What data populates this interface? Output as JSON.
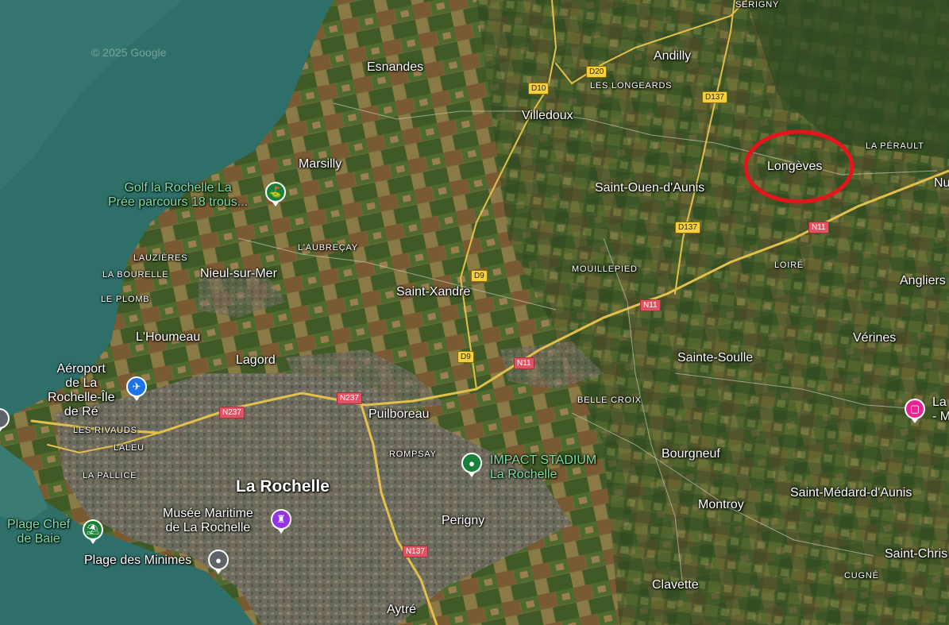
{
  "copyright": "© 2025 Google",
  "localities": {
    "serigny": "SERIGNY",
    "esnandes": "Esnandes",
    "andilly": "Andilly",
    "les_longeards": "LES LONGEARDS",
    "villedoux": "Villedoux",
    "la_perault": "LA PÉRAULT",
    "longeves": "Longèves",
    "nu": "Nu",
    "marsilly": "Marsilly",
    "saint_ouen": "Saint-Ouen-d'Aunis",
    "laubrecay": "L'AUBREÇAY",
    "lauzieres": "LAUZIÈRES",
    "la_bourelle": "LA BOURELLE",
    "nieul": "Nieul-sur-Mer",
    "mouillepied": "MOUILLEPIED",
    "loire": "LOIRÉ",
    "angliers": "Angliers",
    "le_plomb": "LE PLOMB",
    "saint_xandre": "Saint-Xandre",
    "lhoumeau": "L'Houmeau",
    "verines": "Vérines",
    "lagord": "Lagord",
    "sainte_soulle": "Sainte-Soulle",
    "belle_croix": "BELLE CROIX",
    "les_rivauds": "LES RIVAUDS",
    "puilboreau": "Puilboreau",
    "laleu": "LALEU",
    "rompsay": "ROMPSAY",
    "bourgneuf": "Bourgneuf",
    "la_pallice": "LA PALLICE",
    "la_rochelle": "La Rochelle",
    "montroy": "Montroy",
    "saint_medard": "Saint-Médard-d'Aunis",
    "perigny": "Perigny",
    "saint_chris": "Saint-Chris",
    "cugne": "CUGNÉ",
    "clavette": "Clavette",
    "aytre": "Aytré"
  },
  "pois": {
    "golf_line1": "Golf la Rochelle La",
    "golf_line2": "Prée parcours 18 trous...",
    "aeroport_line1": "Aéroport",
    "aeroport_line2": "de La",
    "aeroport_line3": "Rochelle-Île",
    "aeroport_line4": "de Ré",
    "stadium_line1": "IMPACT STADIUM",
    "stadium_line2": "La Rochelle",
    "musee_line1": "Musée Maritime",
    "musee_line2": "de La Rochelle",
    "plage_chef_line1": "Plage Chef",
    "plage_chef_line2": "de Baie",
    "plage_minimes": "Plage des Minimes",
    "hotel_line1": "La",
    "hotel_line2": "- M"
  },
  "roads": {
    "d10": "D10",
    "d20": "D20",
    "d137_top": "D137",
    "d137_mid": "D137",
    "n11_right": "N11",
    "d9_top": "D9",
    "n11_mid": "N11",
    "d9_low": "D9",
    "n11_low": "N11",
    "n237_a": "N237",
    "n237_b": "N237",
    "n137": "N137"
  },
  "icons": {
    "golf": "golf-icon",
    "airport": "airplane-icon",
    "stadium": "stadium-pin-icon",
    "museum": "museum-icon",
    "beach": "beach-icon",
    "generic_place": "place-pin-icon",
    "hotel": "hotel-bed-icon"
  },
  "colors": {
    "highlight_circle": "#e8141b",
    "sea": "#2f6f6a",
    "road_yellow": "#f6cf3d",
    "road_red": "#e05363",
    "poi_green": "#188038",
    "poi_purple": "#9334e6",
    "poi_blue": "#1a73e8",
    "poi_pink": "#e52592"
  }
}
